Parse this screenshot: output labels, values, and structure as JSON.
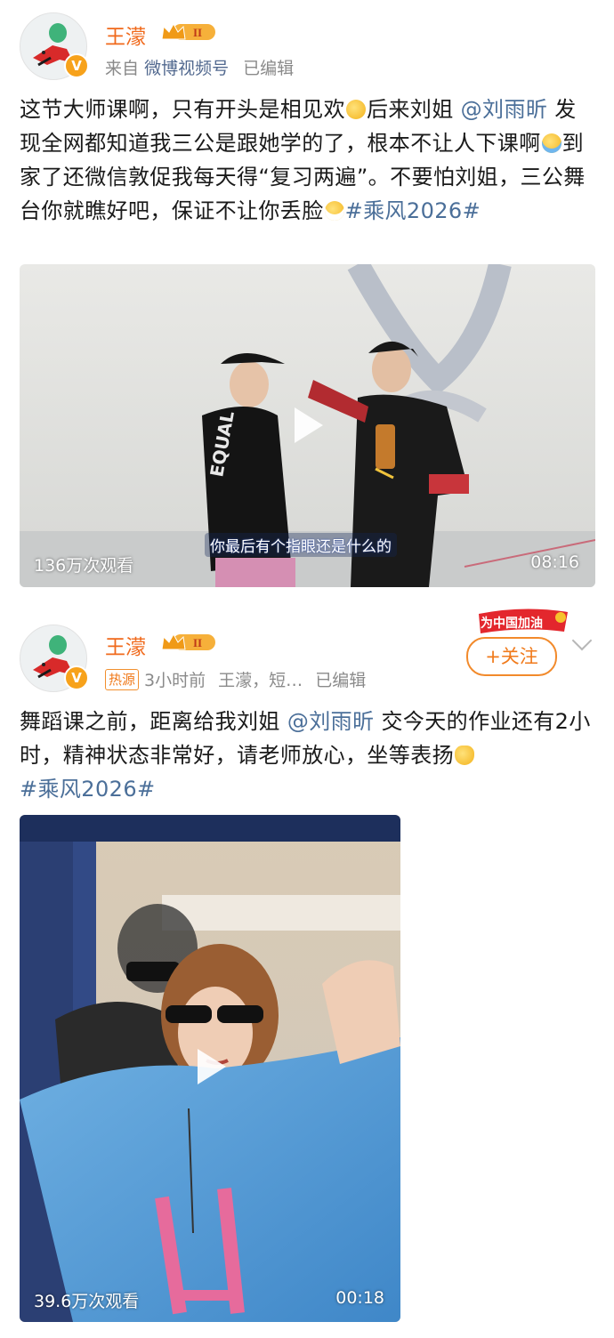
{
  "posts": [
    {
      "username": "王濛",
      "vip_level": "II",
      "meta": {
        "from": "来自",
        "source": "微博视频号",
        "edited": "已编辑"
      },
      "text": {
        "line1_a": "这节大师课啊，只有开头是相见欢",
        "line1_b": "后来刘姐",
        "mention": "@刘雨昕",
        "line2": "发现全网都知道我三公是跟她学的了，根本不让人下课啊",
        "line3": "到家了还微信敦促我每天得“复习两遍”。不要怕刘姐，三公舞台你就瞧好吧，保证不让你丢脸",
        "hashtag": "#乘风2026#"
      },
      "video": {
        "views": "136万次观看",
        "duration": "08:16",
        "subtitle": "你最后有个指眼还是什么的"
      }
    },
    {
      "username": "王濛",
      "vip_level": "II",
      "cheer_label": "为中国加油",
      "follow_label": "+关注",
      "meta": {
        "hot_label": "热源",
        "time": "3小时前",
        "source": "王濛，短…",
        "edited": "已编辑"
      },
      "text": {
        "part1": "舞蹈课之前，距离给我刘姐",
        "mention": "@刘雨昕",
        "part2": "交今天的作业还有2小时，精神状态非常好，请老师放心，坐等表扬",
        "hashtag": "#乘风2026#"
      },
      "video": {
        "views": "39.6万次观看",
        "duration": "00:18"
      }
    }
  ],
  "colors": {
    "username": "#f0691b",
    "link": "#4b6f99",
    "meta": "#8a8a8a",
    "hot": "#f07a1b"
  },
  "icons": [
    "verified-v-icon",
    "vip-crown-icon",
    "play-icon",
    "chevron-down-icon",
    "emoji-shy-icon",
    "emoji-cry-icon",
    "emoji-grin-icon",
    "emoji-raise-hand-icon"
  ]
}
